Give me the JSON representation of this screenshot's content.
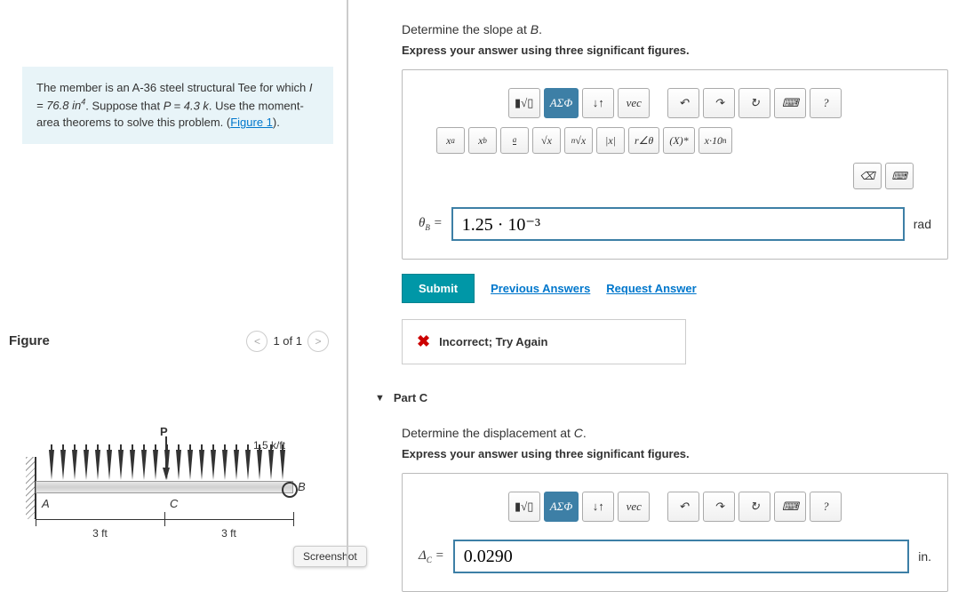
{
  "problem": {
    "text_before_I": "The member is an A-36 steel structural Tee for which ",
    "I_expr": "I = 76.8 in",
    "I_sup": "4",
    "text_mid": ". Suppose that ",
    "P_expr": "P = 4.3 k",
    "text_after": ". Use the moment-area theorems to solve this problem. (",
    "figure_link": "Figure 1",
    "text_end": ")."
  },
  "figure": {
    "title": "Figure",
    "nav_text": "1 of 1",
    "dist_load": "1.5 k/ft",
    "P_label": "P",
    "A_label": "A",
    "B_label": "B",
    "C_label": "C",
    "dim1": "3 ft",
    "dim2": "3 ft"
  },
  "partB": {
    "question": "Determine the slope at B.",
    "instruction": "Express your answer using three significant figures.",
    "toolbar1": {
      "templates": "ΑΣΦ",
      "vec": "vec",
      "help": "?"
    },
    "toolbar2": {
      "xa": "x",
      "xb": "x",
      "frac": "a",
      "sqrt": "√x",
      "nroot": "√x",
      "abs": "|x|",
      "angle": "r∠θ",
      "conj": "(X)*",
      "sci": "x·10"
    },
    "var_html": "θ<sub>B</sub> =",
    "value": "1.25 · 10⁻³",
    "unit": "rad",
    "submit": "Submit",
    "prev": "Previous Answers",
    "request": "Request Answer",
    "feedback": "Incorrect; Try Again"
  },
  "partC": {
    "header": "Part C",
    "question": "Determine the displacement at C.",
    "instruction": "Express your answer using three significant figures.",
    "toolbar1": {
      "templates": "ΑΣΦ",
      "vec": "vec",
      "help": "?"
    },
    "var_html": "Δ<sub>C</sub> =",
    "value": "0.0290",
    "unit": "in."
  },
  "screenshot_label": "Screenshot"
}
